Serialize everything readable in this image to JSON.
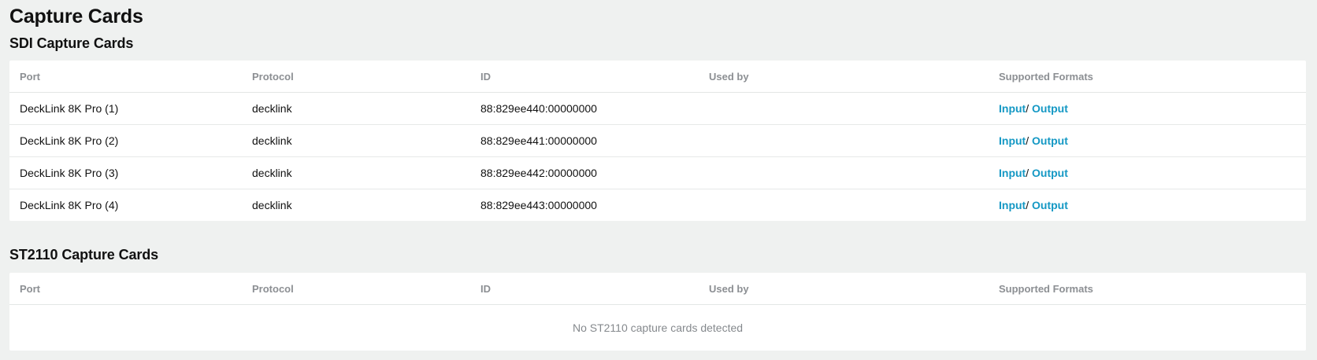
{
  "page": {
    "title": "Capture Cards"
  },
  "sdi": {
    "title": "SDI Capture Cards",
    "headers": {
      "port": "Port",
      "protocol": "Protocol",
      "id": "ID",
      "used_by": "Used by",
      "supported_formats": "Supported Formats"
    },
    "rows": [
      {
        "port": "DeckLink 8K Pro (1)",
        "protocol": "decklink",
        "id": "88:829ee440:00000000",
        "used_by": "",
        "input_label": "Input",
        "separator": "/ ",
        "output_label": "Output"
      },
      {
        "port": "DeckLink 8K Pro (2)",
        "protocol": "decklink",
        "id": "88:829ee441:00000000",
        "used_by": "",
        "input_label": "Input",
        "separator": "/ ",
        "output_label": "Output"
      },
      {
        "port": "DeckLink 8K Pro (3)",
        "protocol": "decklink",
        "id": "88:829ee442:00000000",
        "used_by": "",
        "input_label": "Input",
        "separator": "/ ",
        "output_label": "Output"
      },
      {
        "port": "DeckLink 8K Pro (4)",
        "protocol": "decklink",
        "id": "88:829ee443:00000000",
        "used_by": "",
        "input_label": "Input",
        "separator": "/ ",
        "output_label": "Output"
      }
    ]
  },
  "st2110": {
    "title": "ST2110 Capture Cards",
    "headers": {
      "port": "Port",
      "protocol": "Protocol",
      "id": "ID",
      "used_by": "Used by",
      "supported_formats": "Supported Formats"
    },
    "empty_message": "No ST2110 capture cards detected"
  },
  "colors": {
    "background": "#eff1f0",
    "card": "#ffffff",
    "header_text": "#8c8f93",
    "link": "#1498c4",
    "empty_text": "#85898d"
  }
}
